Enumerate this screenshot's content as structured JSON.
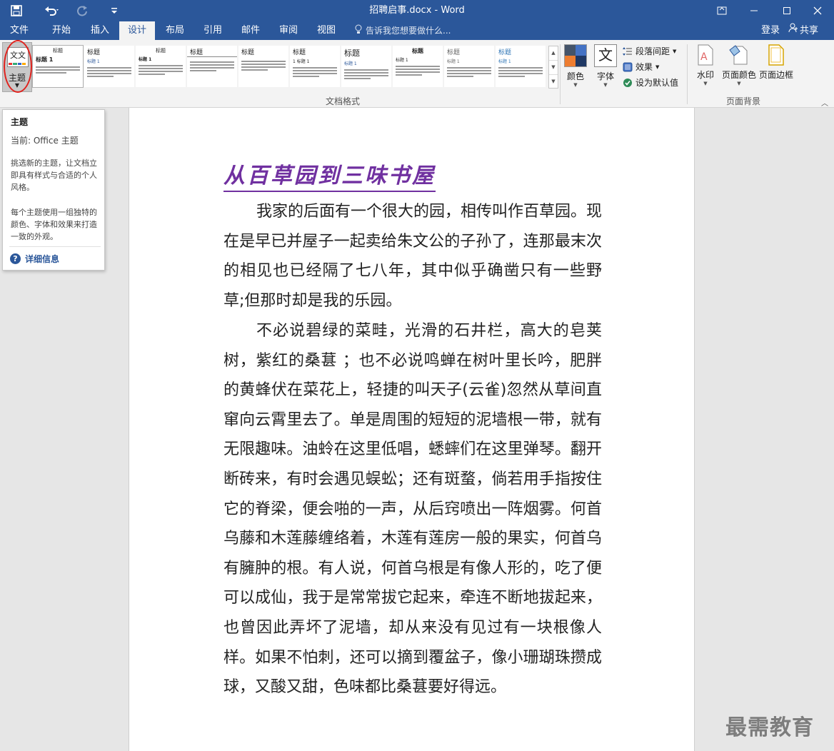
{
  "titlebar": {
    "title": "招聘启事.docx - Word",
    "save_icon": "save-icon",
    "undo_icon": "undo-icon",
    "redo_icon": "redo-icon",
    "customize_icon": "customize-quick-access-icon"
  },
  "tabs": [
    {
      "label": "文件"
    },
    {
      "label": "开始"
    },
    {
      "label": "插入"
    },
    {
      "label": "设计"
    },
    {
      "label": "布局"
    },
    {
      "label": "引用"
    },
    {
      "label": "邮件"
    },
    {
      "label": "审阅"
    },
    {
      "label": "视图"
    }
  ],
  "active_tab": "设计",
  "tellme": "告诉我您想要做什么...",
  "account": {
    "login": "登录",
    "share": "共享"
  },
  "ribbon": {
    "theme_button": "主题",
    "gallery": [
      {
        "title": "标题",
        "sub": "标题 1"
      },
      {
        "title": "标题",
        "sub": "标题 1"
      },
      {
        "title": "标题",
        "sub": "标题 1"
      },
      {
        "title": "标题",
        "sub": ""
      },
      {
        "title": "标题",
        "sub": ""
      },
      {
        "title": "标题",
        "sub": "1 标题 1"
      },
      {
        "title": "标题",
        "sub": "标题 1"
      },
      {
        "title": "标题",
        "sub": "标题 1"
      },
      {
        "title": "标题",
        "sub": "标题 1"
      },
      {
        "title": "标题",
        "sub": "标题 1"
      }
    ],
    "group_doc_format": "文档格式",
    "colors": "颜色",
    "fonts": "字体",
    "fonts_icon_text": "文",
    "paragraph_spacing": "段落间距",
    "effects": "效果",
    "set_default": "设为默认值",
    "watermark": "水印",
    "page_color": "页面颜色",
    "page_border": "页面边框",
    "group_page_background": "页面背景"
  },
  "tooltip": {
    "title": "主题",
    "current": "当前: Office 主题",
    "desc1": "挑选新的主题，让文档立即具有样式与合适的个人风格。",
    "desc2": "每个主题使用一组独特的颜色、字体和效果来打造一致的外观。",
    "more": "详细信息"
  },
  "document": {
    "title": "从百草园到三味书屋",
    "paragraphs": [
      "我家的后面有一个很大的园，相传叫作百草园。现在是早已并屋子一起卖给朱文公的子孙了，连那最末次的相见也已经隔了七八年，其中似乎确凿只有一些野草;但那时却是我的乐园。",
      "不必说碧绿的菜畦，光滑的石井栏，高大的皂荚树，紫红的桑葚 ；也不必说鸣蝉在树叶里长吟，肥胖的黄蜂伏在菜花上，轻捷的叫天子(云雀)忽然从草间直窜向云霄里去了。单是周围的短短的泥墙根一带，就有无限趣味。油蛉在这里低唱，蟋蟀们在这里弹琴。翻开断砖来，有时会遇见蜈蚣；还有斑蝥，倘若用手指按住它的脊梁，便会啪的一声，从后窍喷出一阵烟雾。何首乌藤和木莲藤缠络着，木莲有莲房一般的果实，何首乌有臃肿的根。有人说，何首乌根是有像人形的，吃了便可以成仙，我于是常常拔它起来，牵连不断地拔起来，也曾因此弄坏了泥墙，却从来没有见过有一块根像人样。如果不怕刺，还可以摘到覆盆子，像小珊瑚珠攒成球，又酸又甜，色味都比桑葚要好得远。"
    ]
  },
  "watermark_text": "最需教育",
  "colors": {
    "brand": "#2b579a",
    "title_purple": "#7030a0",
    "highlight": "#e0211c"
  }
}
